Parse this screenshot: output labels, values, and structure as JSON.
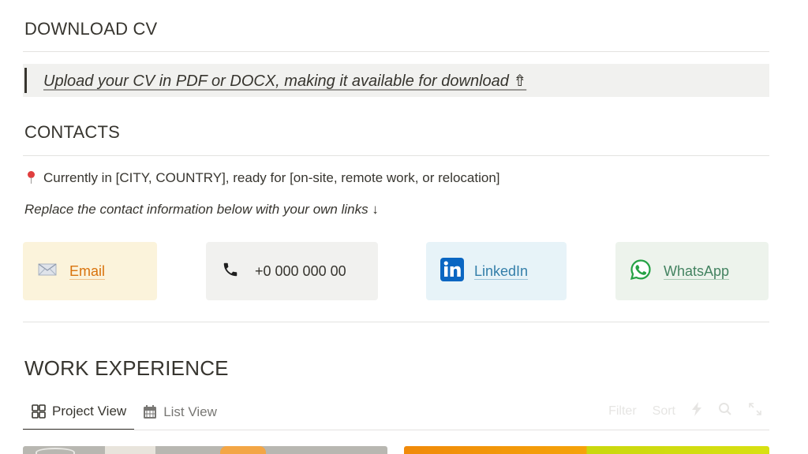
{
  "download": {
    "title": "DOWNLOAD CV",
    "upload_text": "Upload your CV in PDF or DOCX, making it available for download ⇮"
  },
  "contacts": {
    "title": "CONTACTS",
    "location": "Currently in [CITY, COUNTRY], ready for [on-site, remote work, or relocation]",
    "instruction": "Replace the contact information below with your own links ↓",
    "cards": {
      "email": {
        "label": "Email",
        "icon": "envelope-icon"
      },
      "phone": {
        "label": "+0 000 000 00",
        "icon": "phone-icon"
      },
      "linkedin": {
        "label": "LinkedIn",
        "icon": "linkedin-icon"
      },
      "whatsapp": {
        "label": "WhatsApp",
        "icon": "whatsapp-icon"
      }
    }
  },
  "work": {
    "title": "WORK EXPERIENCE",
    "tabs": [
      {
        "label": "Project View",
        "icon": "gallery-icon",
        "active": true
      },
      {
        "label": "List View",
        "icon": "calendar-icon",
        "active": false
      }
    ],
    "toolbar": {
      "filter": "Filter",
      "sort": "Sort"
    }
  },
  "colors": {
    "email_bg": "#fbf3db",
    "email_text": "#d9730d",
    "phone_bg": "#f1f1ef",
    "linkedin_bg": "#e7f3f8",
    "linkedin_text": "#337ea9",
    "whatsapp_bg": "#edf3ec",
    "whatsapp_text": "#448361"
  }
}
